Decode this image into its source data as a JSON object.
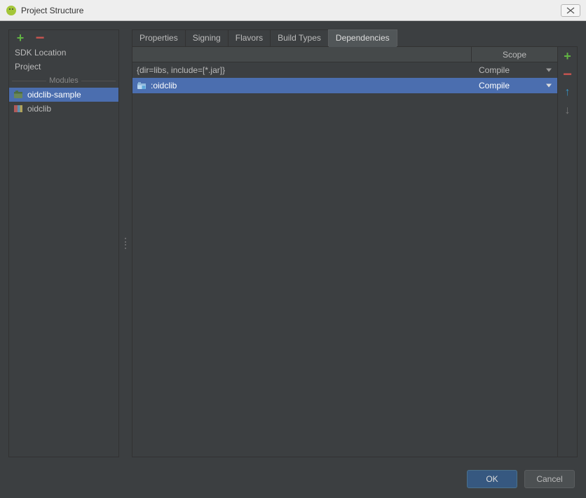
{
  "window": {
    "title": "Project Structure"
  },
  "sidebar": {
    "sdk_location": "SDK Location",
    "project": "Project",
    "modules_header": "Modules",
    "modules": [
      {
        "name": "oidclib-sample",
        "selected": true
      },
      {
        "name": "oidclib",
        "selected": false
      }
    ]
  },
  "tabs": [
    {
      "label": "Properties",
      "active": false
    },
    {
      "label": "Signing",
      "active": false
    },
    {
      "label": "Flavors",
      "active": false
    },
    {
      "label": "Build Types",
      "active": false
    },
    {
      "label": "Dependencies",
      "active": true
    }
  ],
  "dependencies": {
    "scope_header": "Scope",
    "rows": [
      {
        "label": "{dir=libs, include=[*.jar]}",
        "scope": "Compile",
        "selected": false,
        "icon": null
      },
      {
        "label": ":oidclib",
        "scope": "Compile",
        "selected": true,
        "icon": "folder"
      }
    ]
  },
  "footer": {
    "ok": "OK",
    "cancel": "Cancel"
  }
}
